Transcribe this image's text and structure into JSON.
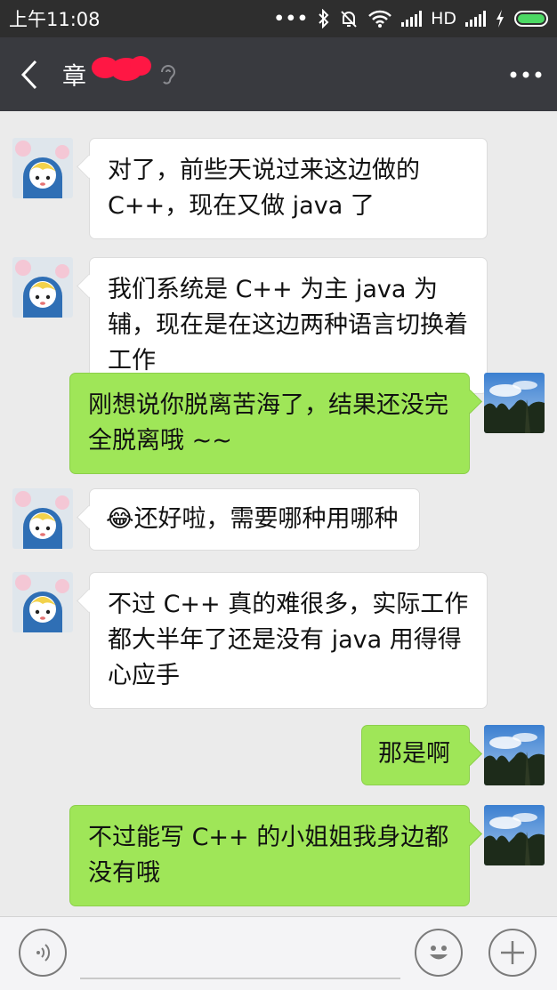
{
  "status_bar": {
    "time": "上午11:08",
    "dots": "•••",
    "network": "HD"
  },
  "header": {
    "title": "章"
  },
  "messages": [
    {
      "side": "in",
      "text": "对了，前些天说过来这边做的 C++，现在又做 java 了"
    },
    {
      "side": "in",
      "text": "我们系统是 C++ 为主 java 为辅，现在是在这边两种语言切换着工作"
    },
    {
      "side": "out",
      "text": "刚想说你脱离苦海了，结果还没完全脱离哦 ~~"
    },
    {
      "side": "in",
      "emoji": "😂",
      "text": "还好啦，需要哪种用哪种"
    },
    {
      "side": "in",
      "text": "不过 C++ 真的难很多，实际工作都大半年了还是没有 java 用得得心应手"
    },
    {
      "side": "out",
      "text": "那是啊"
    },
    {
      "side": "out",
      "text": "不过能写 C++ 的小姐姐我身边都没有哦"
    }
  ],
  "icons": {
    "back": "chevron-left-icon",
    "ear": "earpiece-icon",
    "more": "more-icon",
    "voice": "voice-icon",
    "emoji": "emoji-icon",
    "plus": "plus-icon"
  },
  "colors": {
    "title_bar": "#393a3f",
    "status_bar": "#2e2e2e",
    "chat_bg": "#ebebeb",
    "outgoing_bubble": "#9fe658",
    "incoming_bubble": "#ffffff",
    "redaction": "#ff1744"
  }
}
